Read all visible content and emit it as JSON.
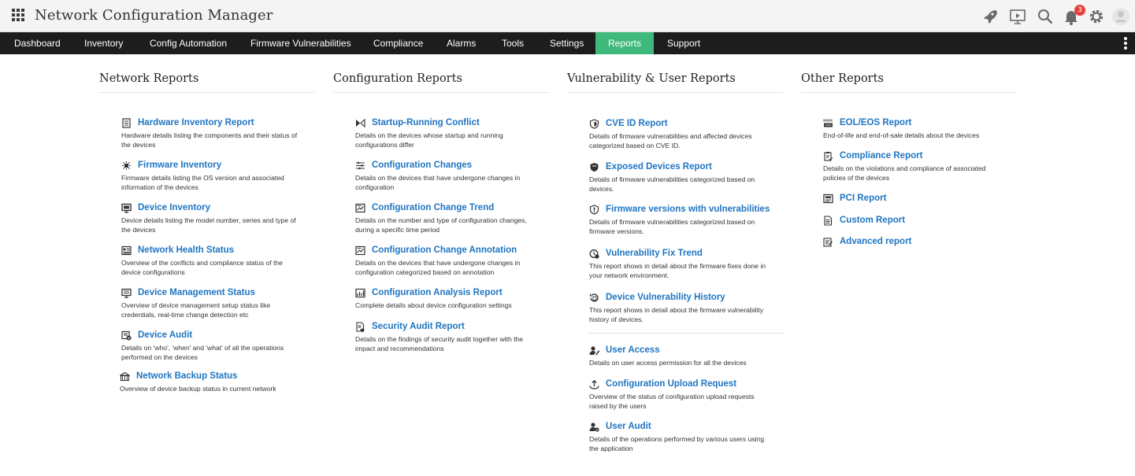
{
  "header": {
    "title": "Network Configuration Manager",
    "notification_count": "3",
    "icons": [
      "rocket-icon",
      "presentation-icon",
      "search-icon",
      "bell-icon",
      "gear-icon",
      "user-avatar-icon"
    ]
  },
  "nav": {
    "items": [
      "Dashboard",
      "Inventory",
      "Config Automation",
      "Firmware Vulnerabilities",
      "Compliance",
      "Alarms",
      "Tools",
      "Settings",
      "Reports",
      "Support"
    ],
    "active": "Reports"
  },
  "colors": {
    "link": "#1f75c2",
    "active_tab": "#3fb87c",
    "navbar": "#1d1d1d",
    "badge": "#e9403c"
  },
  "columns": {
    "network": {
      "title": "Network Reports",
      "reports": [
        {
          "title": "Hardware Inventory Report",
          "desc": "Hardware details listing the components and their status of the devices",
          "icon": "document-icon"
        },
        {
          "title": "Firmware Inventory",
          "desc": "Firmware details listing the OS version and associated information of the devices",
          "icon": "chip-icon"
        },
        {
          "title": "Device Inventory",
          "desc": "Device details listing the model number, series and type of the devices",
          "icon": "monitor-icon"
        },
        {
          "title": "Network Health Status",
          "desc": "Overview of the conflicts and compliance status of the device configurations",
          "icon": "health-card-icon"
        },
        {
          "title": "Device Management Status",
          "desc": "Overview of device management setup status like credentials, real-time change detection etc",
          "icon": "desktop-icon"
        },
        {
          "title": "Device Audit",
          "desc": "Details on 'who', 'when' and 'what' of all the operations performed on the devices",
          "icon": "audit-icon"
        },
        {
          "title": "Network Backup Status",
          "desc": "Overview of device backup status in current network",
          "icon": "backup-icon"
        }
      ]
    },
    "configuration": {
      "title": "Configuration Reports",
      "reports": [
        {
          "title": "Startup-Running Conflict",
          "desc": "Details on the devices whose startup and running configurations differ",
          "icon": "conflict-icon"
        },
        {
          "title": "Configuration Changes",
          "desc": "Details on the devices that have undergone changes in configuration",
          "icon": "sliders-icon"
        },
        {
          "title": "Configuration Change Trend",
          "desc": "Details on the number and type of configuration changes, during a specific time period",
          "icon": "trend-chart-icon"
        },
        {
          "title": "Configuration Change Annotation",
          "desc": "Details on the devices that have undergone changes in configuration categorized based on annotation",
          "icon": "annotation-icon"
        },
        {
          "title": "Configuration Analysis Report",
          "desc": "Complete details about device configuration settings",
          "icon": "analysis-icon"
        },
        {
          "title": "Security Audit Report",
          "desc": "Details on the findings of security audit together with the impact and recommendations",
          "icon": "security-doc-icon"
        }
      ]
    },
    "vulnerability": {
      "title": "Vulnerability & User Reports",
      "reports": [
        {
          "title": "CVE ID Report",
          "desc": "Details of firmware vulnerabilities and affected devices categorized based on CVE ID.",
          "icon": "shield-icon"
        },
        {
          "title": "Exposed Devices Report",
          "desc": "Details of firmware vulnerabilities categorized based on devices.",
          "icon": "shield-filled-icon"
        },
        {
          "title": "Firmware versions with vulnerabilities",
          "desc": "Details of firmware vulnerabilities categorized based on firmware versions.",
          "icon": "shield-alert-icon"
        },
        {
          "title": "Vulnerability Fix Trend",
          "desc": "This report shows in detail about the firmware fixes done in your network environment.",
          "icon": "fix-trend-icon"
        },
        {
          "title": "Device Vulnerability History",
          "desc": "This report shows in detail about the firmware vulnerability history of devices.",
          "icon": "history-icon"
        },
        {
          "title": "User Access",
          "desc": "Details on user access permission for all the devices",
          "icon": "user-key-icon"
        },
        {
          "title": "Configuration Upload Request",
          "desc": "Overview of the status of configuration upload requests raised by the users",
          "icon": "upload-icon"
        },
        {
          "title": "User Audit",
          "desc": "Details of the operations performed by various users using the application",
          "icon": "user-audit-icon"
        }
      ]
    },
    "other": {
      "title": "Other Reports",
      "reports": [
        {
          "title": "EOL/EOS Report",
          "desc": "End-of-life and end-of-sale details about the devices",
          "icon": "eos-icon"
        },
        {
          "title": "Compliance Report",
          "desc": "Details on the violations and compliance of associated policies of the devices",
          "icon": "compliance-icon"
        },
        {
          "title": "PCI Report",
          "desc": "",
          "icon": "pci-icon"
        },
        {
          "title": "Custom Report",
          "desc": "",
          "icon": "custom-doc-icon"
        },
        {
          "title": "Advanced report",
          "desc": "",
          "icon": "advanced-report-icon"
        }
      ]
    }
  }
}
